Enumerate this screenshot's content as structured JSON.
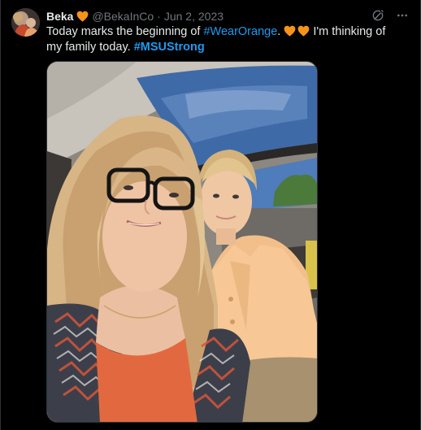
{
  "tweet": {
    "author_name": "Beka",
    "author_handle": "@BekaInCo",
    "separator": "·",
    "date": "Jun 2, 2023",
    "text_part1": "Today marks the beginning of ",
    "hashtag1": "#WearOrange",
    "text_part2": ". ",
    "text_part3": " I'm thinking of my family today. ",
    "hashtag2": "#MSUStrong",
    "badge_icon": "orange-heart-icon",
    "media_alt": "Selfie photo"
  },
  "colors": {
    "background": "#000000",
    "text": "#e7e9ea",
    "muted": "#71767b",
    "link": "#1d9bf0",
    "heart": "#f7931a"
  },
  "icons": {
    "grok": "grok-icon",
    "more": "more-icon"
  }
}
